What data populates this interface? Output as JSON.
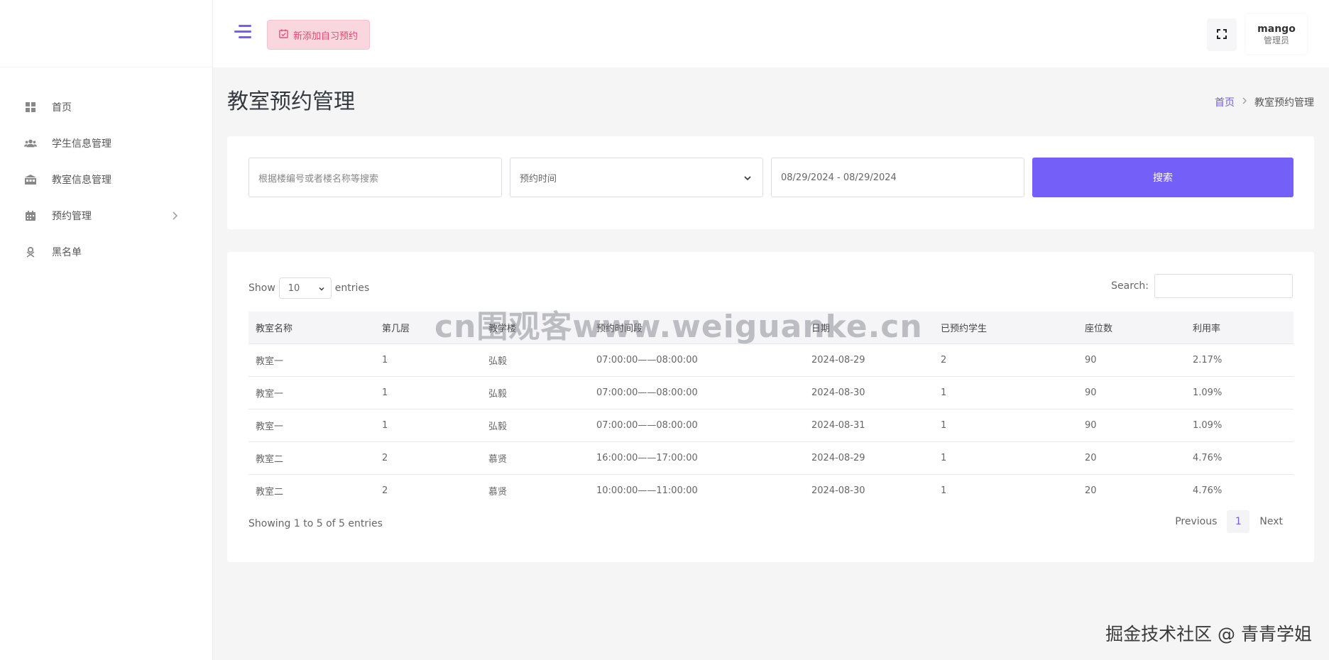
{
  "sidebar": {
    "items": [
      {
        "label": "首页",
        "icon": "grid-icon"
      },
      {
        "label": "学生信息管理",
        "icon": "users-icon"
      },
      {
        "label": "教室信息管理",
        "icon": "building-icon"
      },
      {
        "label": "预约管理",
        "icon": "calendar-icon"
      },
      {
        "label": "黑名单",
        "icon": "person-block-icon"
      }
    ]
  },
  "header": {
    "new_button_label": "新添加自习预约",
    "user_name": "mango",
    "user_role": "管理员"
  },
  "page": {
    "title": "教室预约管理",
    "breadcrumb_home": "首页",
    "breadcrumb_current": "教室预约管理"
  },
  "search": {
    "keyword_placeholder": "根据楼编号或者楼名称等搜索",
    "time_select_value": "预约时间",
    "date_range_value": "08/29/2024 - 08/29/2024",
    "button_label": "搜索"
  },
  "table_controls": {
    "show_label": "Show",
    "page_length": "10",
    "entries_label": "entries",
    "search_label": "Search:"
  },
  "table": {
    "headers": [
      "教室名称",
      "第几层",
      "教学楼",
      "预约时间段",
      "日期",
      "已预约学生",
      "座位数",
      "利用率"
    ],
    "rows": [
      [
        "教室一",
        "1",
        "弘毅",
        "07:00:00——08:00:00",
        "2024-08-29",
        "2",
        "90",
        "2.17%"
      ],
      [
        "教室一",
        "1",
        "弘毅",
        "07:00:00——08:00:00",
        "2024-08-30",
        "1",
        "90",
        "1.09%"
      ],
      [
        "教室一",
        "1",
        "弘毅",
        "07:00:00——08:00:00",
        "2024-08-31",
        "1",
        "90",
        "1.09%"
      ],
      [
        "教室二",
        "2",
        "慕贤",
        "16:00:00——17:00:00",
        "2024-08-29",
        "1",
        "20",
        "4.76%"
      ],
      [
        "教室二",
        "2",
        "慕贤",
        "10:00:00——11:00:00",
        "2024-08-30",
        "1",
        "20",
        "4.76%"
      ]
    ]
  },
  "pagination": {
    "info": "Showing 1 to 5 of 5 entries",
    "previous": "Previous",
    "current_page": "1",
    "next": "Next"
  },
  "watermarks": {
    "center": "cn围观客www.weiguanke.cn",
    "corner": "掘金技术社区 @ 青青学姐"
  },
  "colors": {
    "accent": "#7460f8",
    "new_button_bg": "#f9d7de",
    "new_button_text": "#e0496c"
  }
}
